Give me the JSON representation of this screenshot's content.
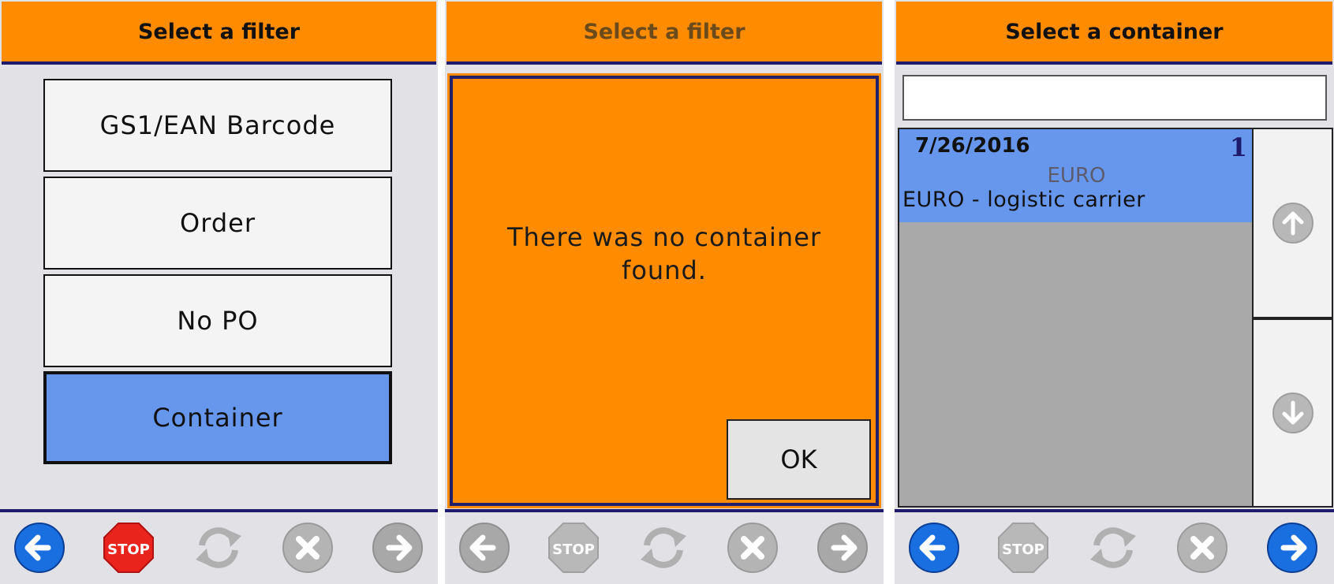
{
  "screen1": {
    "header": "Select a filter",
    "options": [
      "GS1/EAN Barcode",
      "Order",
      "No PO",
      "Container"
    ],
    "selected_option": "Container"
  },
  "screen2": {
    "header": "Select a filter",
    "dialog_message": "There was no container found.",
    "ok_label": "OK"
  },
  "screen3": {
    "header": "Select a container",
    "search": {
      "value": "",
      "placeholder": ""
    },
    "items": [
      {
        "date": "7/26/2016",
        "count": "1",
        "code": "EURO",
        "description": "EURO - logistic carrier"
      }
    ]
  },
  "footer_labels": {
    "stop": "STOP"
  },
  "colors": {
    "header_orange": "#ff8c00",
    "accent_blue": "#6797ec",
    "border_navy": "#1f1a6b",
    "panel_bg": "#e2e1e6"
  },
  "icons": [
    "back-arrow-icon",
    "stop-sign-icon",
    "refresh-icon",
    "cancel-icon",
    "forward-arrow-icon",
    "scroll-up-icon",
    "scroll-down-icon"
  ]
}
